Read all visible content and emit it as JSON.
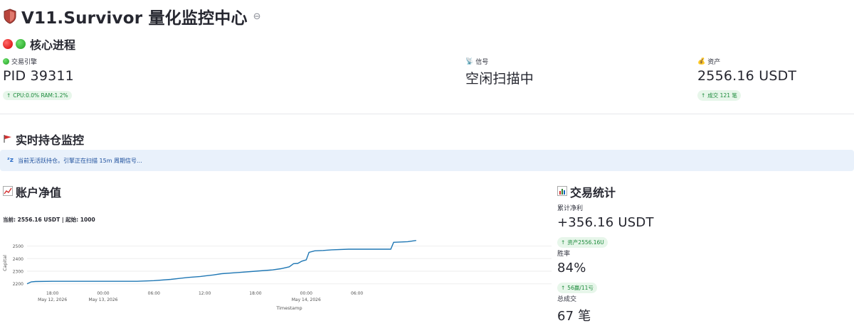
{
  "page": {
    "title": "V11.Survivor 量化监控中心",
    "link_icon": "link-icon"
  },
  "core": {
    "header": "核心进程",
    "engine": {
      "label": "交易引擎",
      "value": "PID 39311",
      "delta": "CPU:0.0% RAM:1.2%"
    },
    "signal": {
      "label": "信号",
      "value": "空闲扫描中"
    },
    "assets": {
      "label": "资产",
      "value": "2556.16 USDT",
      "delta": "成交 121 笔"
    }
  },
  "positions": {
    "header": "实时持仓监控",
    "info": "当前无活跃持仓。引擎正在扫描 15m 周期信号..."
  },
  "equity": {
    "header": "账户净值",
    "subtitle": "当前: 2556.16 USDT | 起始: 1000"
  },
  "stats": {
    "header": "交易统计",
    "net_profit": {
      "label": "累计净利",
      "value": "+356.16 USDT",
      "delta": "资产2556.16U"
    },
    "win_rate": {
      "label": "胜率",
      "value": "84%",
      "delta": "56赢/11亏"
    },
    "total_trades": {
      "label": "总成交",
      "value": "67 笔"
    }
  },
  "colors": {
    "line": "#1f77b4",
    "delta_bg": "#e7f6ea",
    "delta_fg": "#1b8a3a",
    "info_bg": "#e9f1fb"
  },
  "chart_data": {
    "type": "line",
    "title": "",
    "xlabel": "Timestamp",
    "ylabel": "Capital",
    "yticks": [
      2200,
      2300,
      2400,
      2500
    ],
    "ylim": [
      2170,
      2560
    ],
    "xlim": [
      "2026-05-12 15:00",
      "2026-05-15 05:00"
    ],
    "xticks": [
      {
        "t": "2026-05-12 18:00",
        "label": "18:00",
        "sub": "May 12, 2026"
      },
      {
        "t": "2026-05-13 00:00",
        "label": "00:00",
        "sub": "May 13, 2026"
      },
      {
        "t": "2026-05-13 06:00",
        "label": "06:00",
        "sub": ""
      },
      {
        "t": "2026-05-13 12:00",
        "label": "12:00",
        "sub": ""
      },
      {
        "t": "2026-05-13 18:00",
        "label": "18:00",
        "sub": ""
      },
      {
        "t": "2026-05-14 00:00",
        "label": "00:00",
        "sub": "May 14, 2026"
      },
      {
        "t": "2026-05-14 06:00",
        "label": "06:00",
        "sub": ""
      }
    ],
    "grid": true,
    "series": [
      {
        "x": [
          "2026-05-12 15:00",
          "2026-05-12 15:30",
          "2026-05-12 16:00",
          "2026-05-12 18:00",
          "2026-05-13 00:00",
          "2026-05-13 04:00",
          "2026-05-13 06:00",
          "2026-05-13 08:00",
          "2026-05-13 10:00",
          "2026-05-13 11:30",
          "2026-05-13 12:00",
          "2026-05-13 13:00",
          "2026-05-13 14:00",
          "2026-05-13 16:00",
          "2026-05-13 18:00",
          "2026-05-13 20:00",
          "2026-05-13 21:00",
          "2026-05-13 22:00",
          "2026-05-13 22:30",
          "2026-05-13 23:00",
          "2026-05-13 23:30",
          "2026-05-14 00:00",
          "2026-05-14 00:20",
          "2026-05-14 01:00",
          "2026-05-14 02:00",
          "2026-05-14 03:00",
          "2026-05-14 05:00",
          "2026-05-14 08:00",
          "2026-05-14 10:00",
          "2026-05-14 10:20",
          "2026-05-14 12:00",
          "2026-05-14 13:00"
        ],
        "y": [
          2200,
          2215,
          2218,
          2220,
          2220,
          2220,
          2225,
          2235,
          2250,
          2258,
          2262,
          2270,
          2280,
          2290,
          2300,
          2310,
          2320,
          2335,
          2360,
          2362,
          2380,
          2390,
          2450,
          2462,
          2465,
          2470,
          2475,
          2475,
          2475,
          2530,
          2535,
          2545
        ]
      }
    ]
  }
}
